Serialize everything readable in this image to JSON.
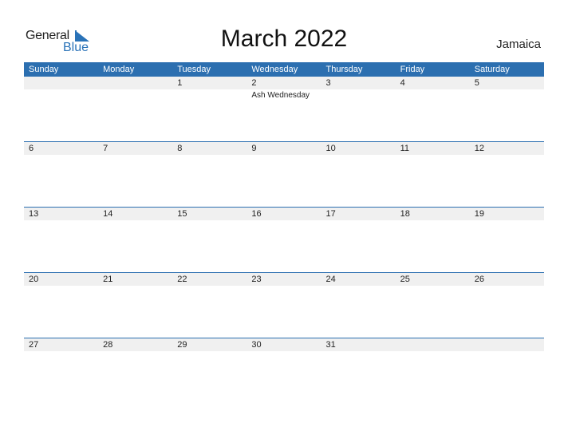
{
  "logo": {
    "general": "General",
    "blue": "Blue"
  },
  "title": "March 2022",
  "country": "Jamaica",
  "colors": {
    "accent": "#2c6fb0",
    "row_bg": "#f0f0f0"
  },
  "weekdays": [
    "Sunday",
    "Monday",
    "Tuesday",
    "Wednesday",
    "Thursday",
    "Friday",
    "Saturday"
  ],
  "weeks": [
    {
      "days": [
        "",
        "",
        "1",
        "2",
        "3",
        "4",
        "5"
      ],
      "events": [
        "",
        "",
        "",
        "Ash Wednesday",
        "",
        "",
        ""
      ]
    },
    {
      "days": [
        "6",
        "7",
        "8",
        "9",
        "10",
        "11",
        "12"
      ],
      "events": [
        "",
        "",
        "",
        "",
        "",
        "",
        ""
      ]
    },
    {
      "days": [
        "13",
        "14",
        "15",
        "16",
        "17",
        "18",
        "19"
      ],
      "events": [
        "",
        "",
        "",
        "",
        "",
        "",
        ""
      ]
    },
    {
      "days": [
        "20",
        "21",
        "22",
        "23",
        "24",
        "25",
        "26"
      ],
      "events": [
        "",
        "",
        "",
        "",
        "",
        "",
        ""
      ]
    },
    {
      "days": [
        "27",
        "28",
        "29",
        "30",
        "31",
        "",
        ""
      ],
      "events": [
        "",
        "",
        "",
        "",
        "",
        "",
        ""
      ]
    }
  ]
}
